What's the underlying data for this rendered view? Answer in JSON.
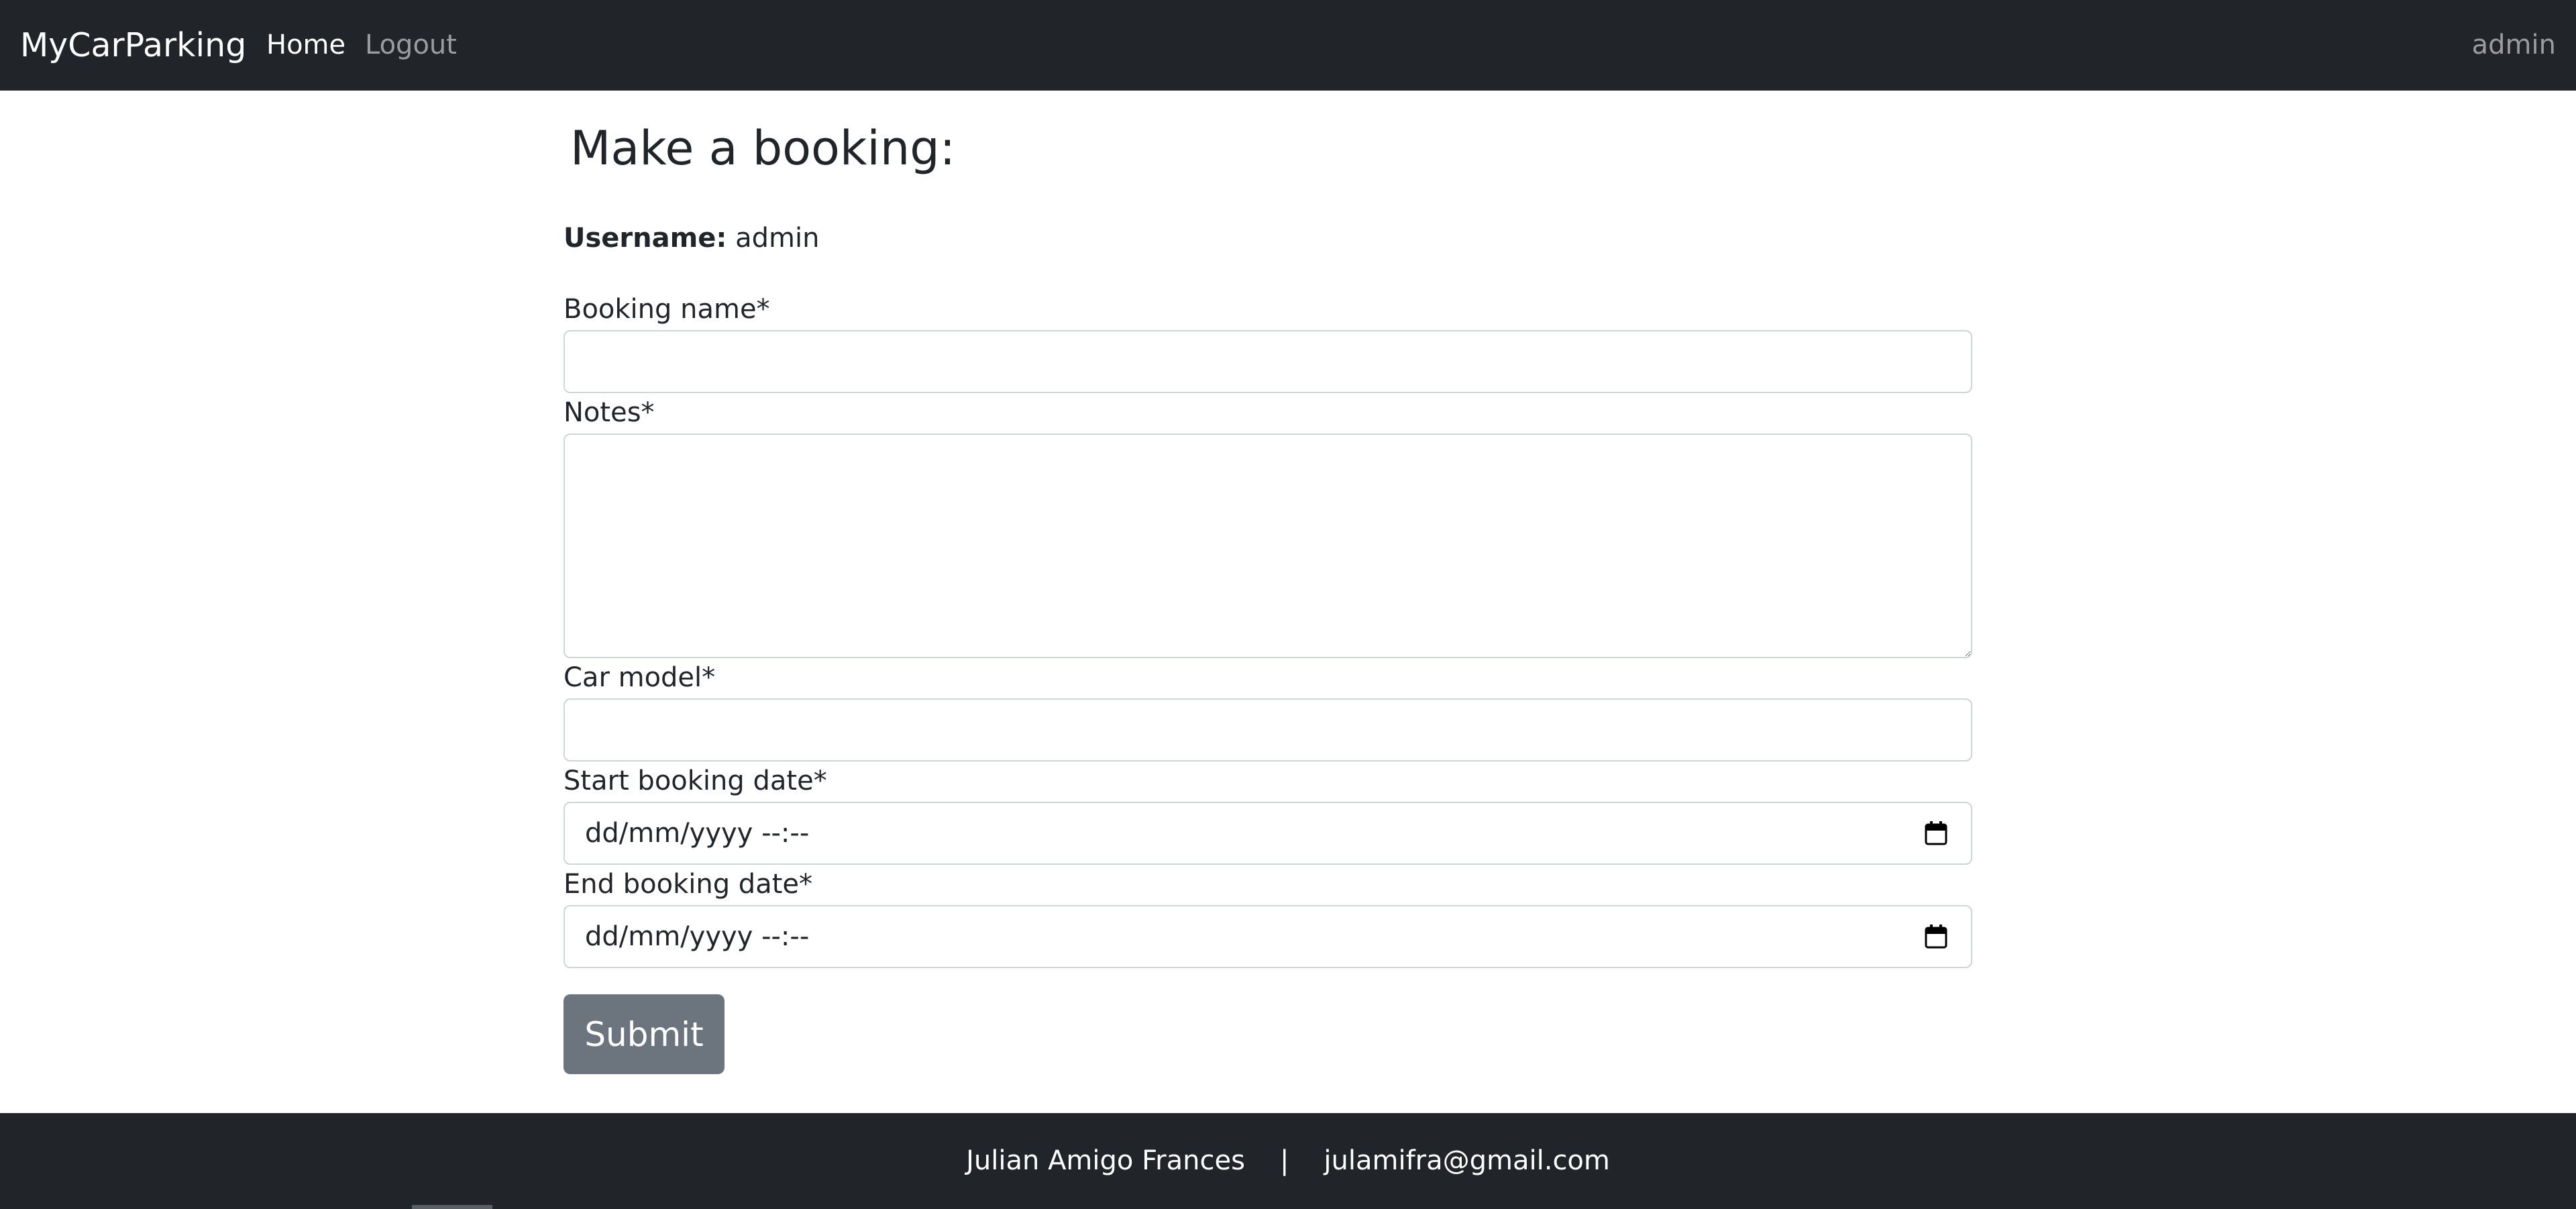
{
  "navbar": {
    "brand": "MyCarParking",
    "links": [
      {
        "label": "Home",
        "active": true
      },
      {
        "label": "Logout",
        "active": false
      }
    ],
    "user": "admin"
  },
  "main": {
    "title": "Make a booking:",
    "username_label": "Username:",
    "username_value": "admin",
    "fields": {
      "booking_name": {
        "label": "Booking name*",
        "value": ""
      },
      "notes": {
        "label": "Notes*",
        "value": ""
      },
      "car_model": {
        "label": "Car model*",
        "value": ""
      },
      "start_date": {
        "label": "Start booking date*",
        "placeholder": "dd/mm/yyyy --:--"
      },
      "end_date": {
        "label": "End booking date*",
        "placeholder": "dd/mm/yyyy --:--"
      }
    },
    "submit_label": "Submit"
  },
  "footer": {
    "author": "Julian Amigo Frances",
    "separator": "|",
    "email": "julamifra@gmail.com"
  },
  "colors": {
    "navbar_bg": "#212529",
    "button_bg": "#6c757d",
    "input_border": "#ced4da"
  },
  "icons": [
    "calendar-icon"
  ]
}
